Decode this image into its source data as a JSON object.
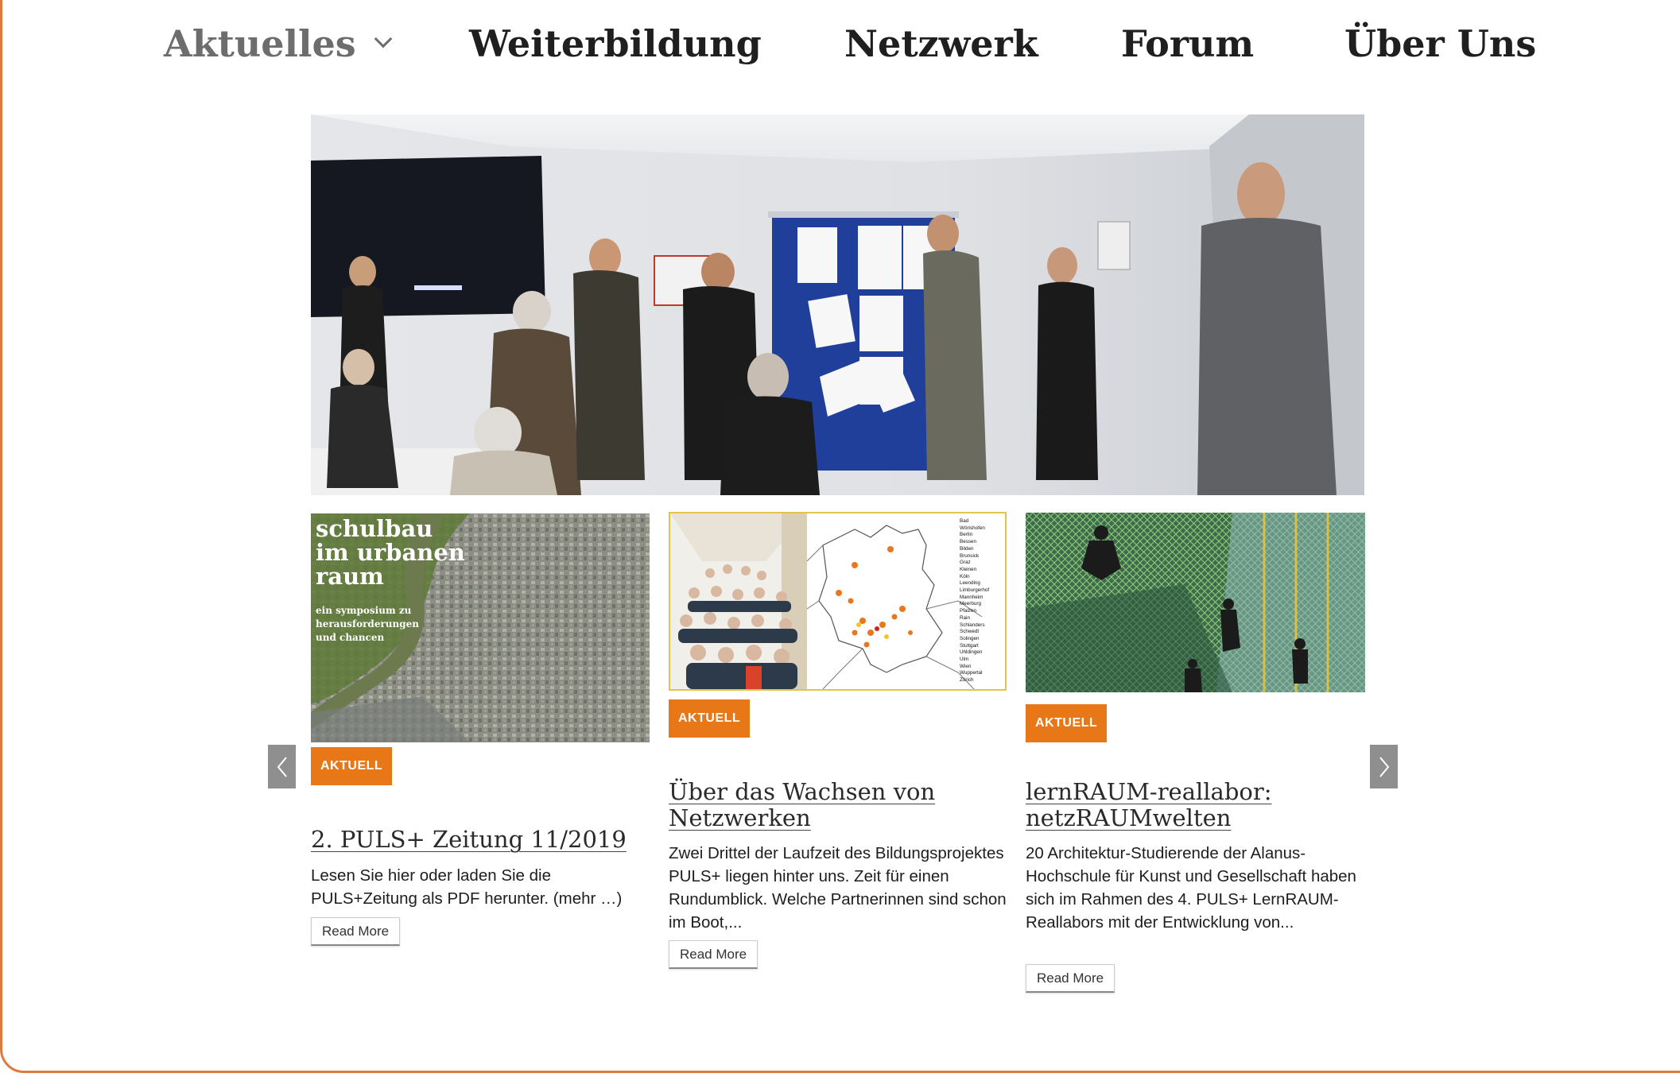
{
  "nav": {
    "items": [
      {
        "label": "Aktuelles",
        "active": true
      },
      {
        "label": "Weiterbildung"
      },
      {
        "label": "Netzwerk"
      },
      {
        "label": "Forum"
      },
      {
        "label": "Über Uns"
      }
    ]
  },
  "colors": {
    "accent": "#e87817",
    "frame": "#e07a3c",
    "arrow": "#8f8f8f"
  },
  "hero": {
    "image": "group-workshop-photo"
  },
  "cards": [
    {
      "thumb_lines": [
        "schulbau",
        "im urbanen",
        "raum"
      ],
      "thumb_sub": [
        "ein symposium zu",
        "herausforderungen",
        "und chancen"
      ],
      "badge": "AKTUELL",
      "title": "2. PULS+ Zeitung 11/2019",
      "text": "Lesen Sie hier oder laden Sie die PULS+Zeitung als PDF herunter. (mehr …)",
      "read_more": "Read More"
    },
    {
      "map_cities": [
        "Bad",
        "Wörishofen",
        "Berlin",
        "Bessen",
        "Bilden",
        "Brunsick",
        "Graz",
        "Kleinen",
        "Köln",
        "Leending",
        "Limburgerhof",
        "Mannheim",
        "Meerburg",
        "Pfalzen",
        "Rain",
        "Schlanders",
        "Schwedt",
        "Solingen",
        "Stuttgart",
        "Uhldingen",
        "Ulm",
        "Wien",
        "Wuppertal",
        "Zürich"
      ],
      "badge": "AKTUELL",
      "title": "Über das Wachsen von Netzwerken",
      "text": "Zwei Drittel der Laufzeit des Bildungsprojektes PULS+ liegen hinter uns. Zeit für einen Rundumblick. Welche Partnerinnen sind schon im Boot,...",
      "read_more": "Read More"
    },
    {
      "badge": "AKTUELL",
      "title": "lernRAUM-reallabor: netzRAUMwelten",
      "text": "20 Architektur-Studierende der Alanus-Hochschule für Kunst und Gesellschaft haben sich im Rahmen des 4. PULS+ LernRAUM-Reallabors mit der Entwicklung von...",
      "read_more": "Read More"
    }
  ],
  "carousel": {
    "prev": "previous-arrow",
    "next": "next-arrow"
  }
}
